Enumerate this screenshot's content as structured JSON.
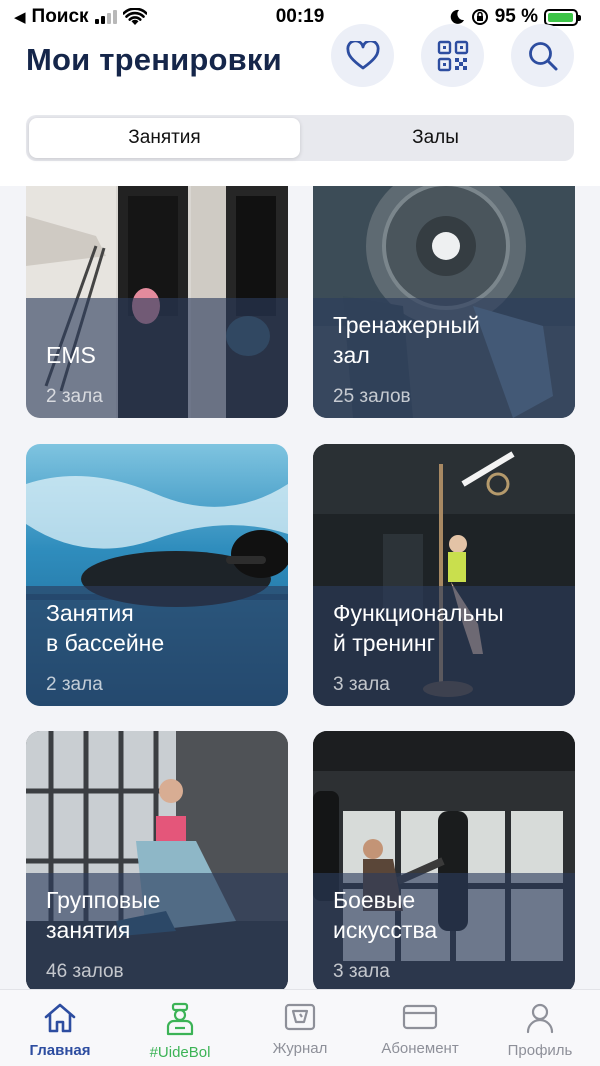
{
  "status_bar": {
    "back_label": "Поиск",
    "time": "00:19",
    "battery_percent": "95 %",
    "battery_level": 0.95
  },
  "header": {
    "title": "Мои тренировки",
    "actions": [
      {
        "icon": "heart-icon"
      },
      {
        "icon": "qr-code-icon"
      },
      {
        "icon": "search-icon"
      }
    ]
  },
  "segmented": {
    "options": [
      "Занятия",
      "Залы"
    ],
    "selected": "Занятия"
  },
  "cards": [
    {
      "title": "EMS",
      "count": "2 зала"
    },
    {
      "title": "Тренажерный\nзал",
      "count": "25 залов"
    },
    {
      "title": "Занятия\nв бассейне",
      "count": "2 зала"
    },
    {
      "title": "Функциональны\nй тренинг",
      "count": "3 зала"
    },
    {
      "title": "Групповые\nзанятия",
      "count": "46 залов"
    },
    {
      "title": "Боевые\nискусства",
      "count": "3 зала"
    }
  ],
  "tabbar": {
    "items": [
      {
        "label": "Главная",
        "icon": "home-icon",
        "active": true
      },
      {
        "label": "#UideBol",
        "icon": "trainer-icon",
        "active": false
      },
      {
        "label": "Журнал",
        "icon": "journal-icon",
        "active": false
      },
      {
        "label": "Абонемент",
        "icon": "card-icon",
        "active": false
      },
      {
        "label": "Профиль",
        "icon": "profile-icon",
        "active": false
      }
    ]
  },
  "colors": {
    "accent": "#2d4da0",
    "title": "#15264a",
    "brand_green": "#3cb356",
    "round_button_bg": "#eceff7",
    "card_overlay": "#2c3c5c"
  }
}
